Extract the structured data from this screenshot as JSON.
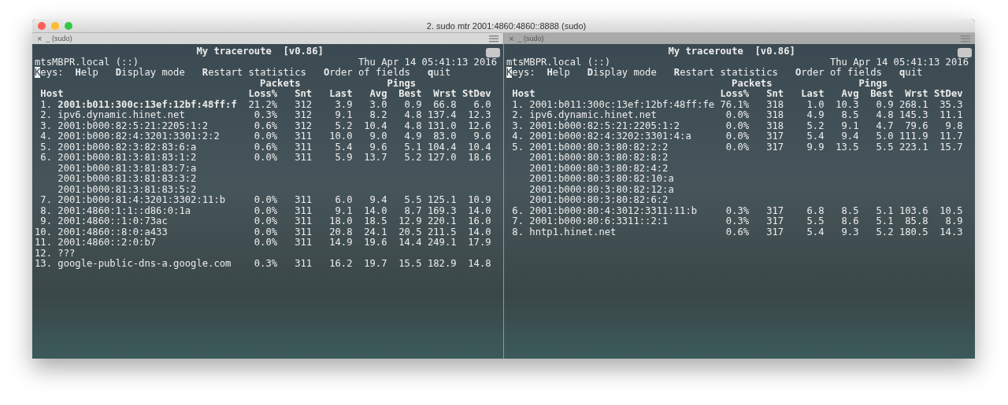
{
  "window": {
    "title": "2. sudo mtr 2001:4860:4860::8888 (sudo)"
  },
  "panes": [
    {
      "active": true,
      "tab": {
        "close": "×",
        "title": "_ (sudo)"
      },
      "heading": "My traceroute  [v0.86]",
      "hostname": "mtsMBPR.local (::)",
      "datetime": "Thu Apr 14 05:41:13 2016",
      "keys_label": "Keys:",
      "keys": [
        "**H**elp",
        "**D**isplay mode",
        "**R**estart statistics",
        "**O**rder of fields",
        "**q**uit"
      ],
      "groups": [
        "Packets",
        "Pings"
      ],
      "columns": [
        "Host",
        "Loss%",
        "Snt",
        "Last",
        "Avg",
        "Best",
        "Wrst",
        "StDev"
      ],
      "hops": [
        {
          "number": "1.",
          "bold": true,
          "hosts": [
            "2001:b011:300c:13ef:12bf:48ff:f"
          ],
          "stats": [
            "21.2%",
            "312",
            "3.9",
            "3.0",
            "0.9",
            "66.8",
            "6.0"
          ]
        },
        {
          "number": "2.",
          "bold": false,
          "hosts": [
            "ipv6.dynamic.hinet.net"
          ],
          "stats": [
            "0.3%",
            "312",
            "9.1",
            "8.2",
            "4.8",
            "137.4",
            "12.3"
          ]
        },
        {
          "number": "3.",
          "bold": false,
          "hosts": [
            "2001:b000:82:5:21:2205:1:2"
          ],
          "stats": [
            "0.6%",
            "312",
            "5.2",
            "10.4",
            "4.8",
            "131.0",
            "12.6"
          ]
        },
        {
          "number": "4.",
          "bold": false,
          "hosts": [
            "2001:b000:82:4:3201:3301:2:2"
          ],
          "stats": [
            "0.0%",
            "311",
            "10.0",
            "9.0",
            "4.9",
            "83.0",
            "9.6"
          ]
        },
        {
          "number": "5.",
          "bold": false,
          "hosts": [
            "2001:b000:82:3:82:83:6:a"
          ],
          "stats": [
            "0.6%",
            "311",
            "5.4",
            "9.6",
            "5.1",
            "104.4",
            "10.4"
          ]
        },
        {
          "number": "6.",
          "bold": false,
          "hosts": [
            "2001:b000:81:3:81:83:1:2",
            "2001:b000:81:3:81:83:7:a",
            "2001:b000:81:3:81:83:3:2",
            "2001:b000:81:3:81:83:5:2"
          ],
          "stats": [
            "0.0%",
            "311",
            "5.9",
            "13.7",
            "5.2",
            "127.0",
            "18.6"
          ]
        },
        {
          "number": "7.",
          "bold": false,
          "hosts": [
            "2001:b000:81:4:3201:3302:11:b"
          ],
          "stats": [
            "0.0%",
            "311",
            "6.0",
            "9.4",
            "5.5",
            "125.1",
            "10.9"
          ]
        },
        {
          "number": "8.",
          "bold": false,
          "hosts": [
            "2001:4860:1:1::d86:0:1a"
          ],
          "stats": [
            "0.0%",
            "311",
            "9.1",
            "14.0",
            "8.7",
            "169.3",
            "14.0"
          ]
        },
        {
          "number": "9.",
          "bold": false,
          "hosts": [
            "2001:4860::1:0:73ac"
          ],
          "stats": [
            "0.0%",
            "311",
            "18.0",
            "18.5",
            "12.9",
            "220.1",
            "16.0"
          ]
        },
        {
          "number": "10.",
          "bold": false,
          "hosts": [
            "2001:4860::8:0:a433"
          ],
          "stats": [
            "0.0%",
            "311",
            "20.8",
            "24.1",
            "20.5",
            "211.5",
            "14.0"
          ]
        },
        {
          "number": "11.",
          "bold": false,
          "hosts": [
            "2001:4860::2:0:b7"
          ],
          "stats": [
            "0.0%",
            "311",
            "14.9",
            "19.6",
            "14.4",
            "249.1",
            "17.9"
          ]
        },
        {
          "number": "12.",
          "bold": false,
          "hosts": [
            "???"
          ]
        },
        {
          "number": "13.",
          "bold": false,
          "hosts": [
            "google-public-dns-a.google.com"
          ],
          "stats": [
            "0.3%",
            "311",
            "16.2",
            "19.7",
            "15.5",
            "182.9",
            "14.8"
          ]
        }
      ]
    },
    {
      "active": false,
      "tab": {
        "close": "×",
        "title": "_ (sudo)"
      },
      "heading": "My traceroute  [v0.86]",
      "hostname": "mtsMBPR.local (::)",
      "datetime": "Thu Apr 14 05:41:13 2016",
      "keys_label": "Keys:",
      "keys": [
        "**H**elp",
        "**D**isplay mode",
        "**R**estart statistics",
        "**O**rder of fields",
        "**q**uit"
      ],
      "groups": [
        "Packets",
        "Pings"
      ],
      "columns": [
        "Host",
        "Loss%",
        "Snt",
        "Last",
        "Avg",
        "Best",
        "Wrst",
        "StDev"
      ],
      "hops": [
        {
          "number": "1.",
          "bold": false,
          "hosts": [
            "2001:b011:300c:13ef:12bf:48ff:fe"
          ],
          "stats": [
            "76.1%",
            "318",
            "1.0",
            "10.3",
            "0.9",
            "268.1",
            "35.3"
          ]
        },
        {
          "number": "2.",
          "bold": false,
          "hosts": [
            "ipv6.dynamic.hinet.net"
          ],
          "stats": [
            "0.0%",
            "318",
            "4.9",
            "8.5",
            "4.8",
            "145.3",
            "11.1"
          ]
        },
        {
          "number": "3.",
          "bold": false,
          "hosts": [
            "2001:b000:82:5:21:2205:1:2"
          ],
          "stats": [
            "0.0%",
            "318",
            "5.2",
            "9.1",
            "4.7",
            "79.6",
            "9.8"
          ]
        },
        {
          "number": "4.",
          "bold": false,
          "hosts": [
            "2001:b000:82:4:3202:3301:4:a"
          ],
          "stats": [
            "0.0%",
            "317",
            "5.4",
            "9.4",
            "5.0",
            "111.9",
            "11.7"
          ]
        },
        {
          "number": "5.",
          "bold": false,
          "hosts": [
            "2001:b000:80:3:80:82:2:2",
            "2001:b000:80:3:80:82:8:2",
            "2001:b000:80:3:80:82:4:2",
            "2001:b000:80:3:80:82:10:a",
            "2001:b000:80:3:80:82:12:a",
            "2001:b000:80:3:80:82:6:2"
          ],
          "stats": [
            "0.0%",
            "317",
            "9.9",
            "13.5",
            "5.5",
            "223.1",
            "15.7"
          ]
        },
        {
          "number": "6.",
          "bold": false,
          "hosts": [
            "2001:b000:80:4:3012:3311:11:b"
          ],
          "stats": [
            "0.3%",
            "317",
            "6.8",
            "8.5",
            "5.1",
            "103.6",
            "10.5"
          ]
        },
        {
          "number": "7.",
          "bold": false,
          "hosts": [
            "2001:b000:80:6:3311::2:1"
          ],
          "stats": [
            "0.3%",
            "317",
            "5.5",
            "8.6",
            "5.1",
            "85.8",
            "8.9"
          ]
        },
        {
          "number": "8.",
          "bold": false,
          "hosts": [
            "hntp1.hinet.net"
          ],
          "stats": [
            "0.6%",
            "317",
            "5.4",
            "9.3",
            "5.2",
            "180.5",
            "14.3"
          ]
        }
      ]
    }
  ]
}
